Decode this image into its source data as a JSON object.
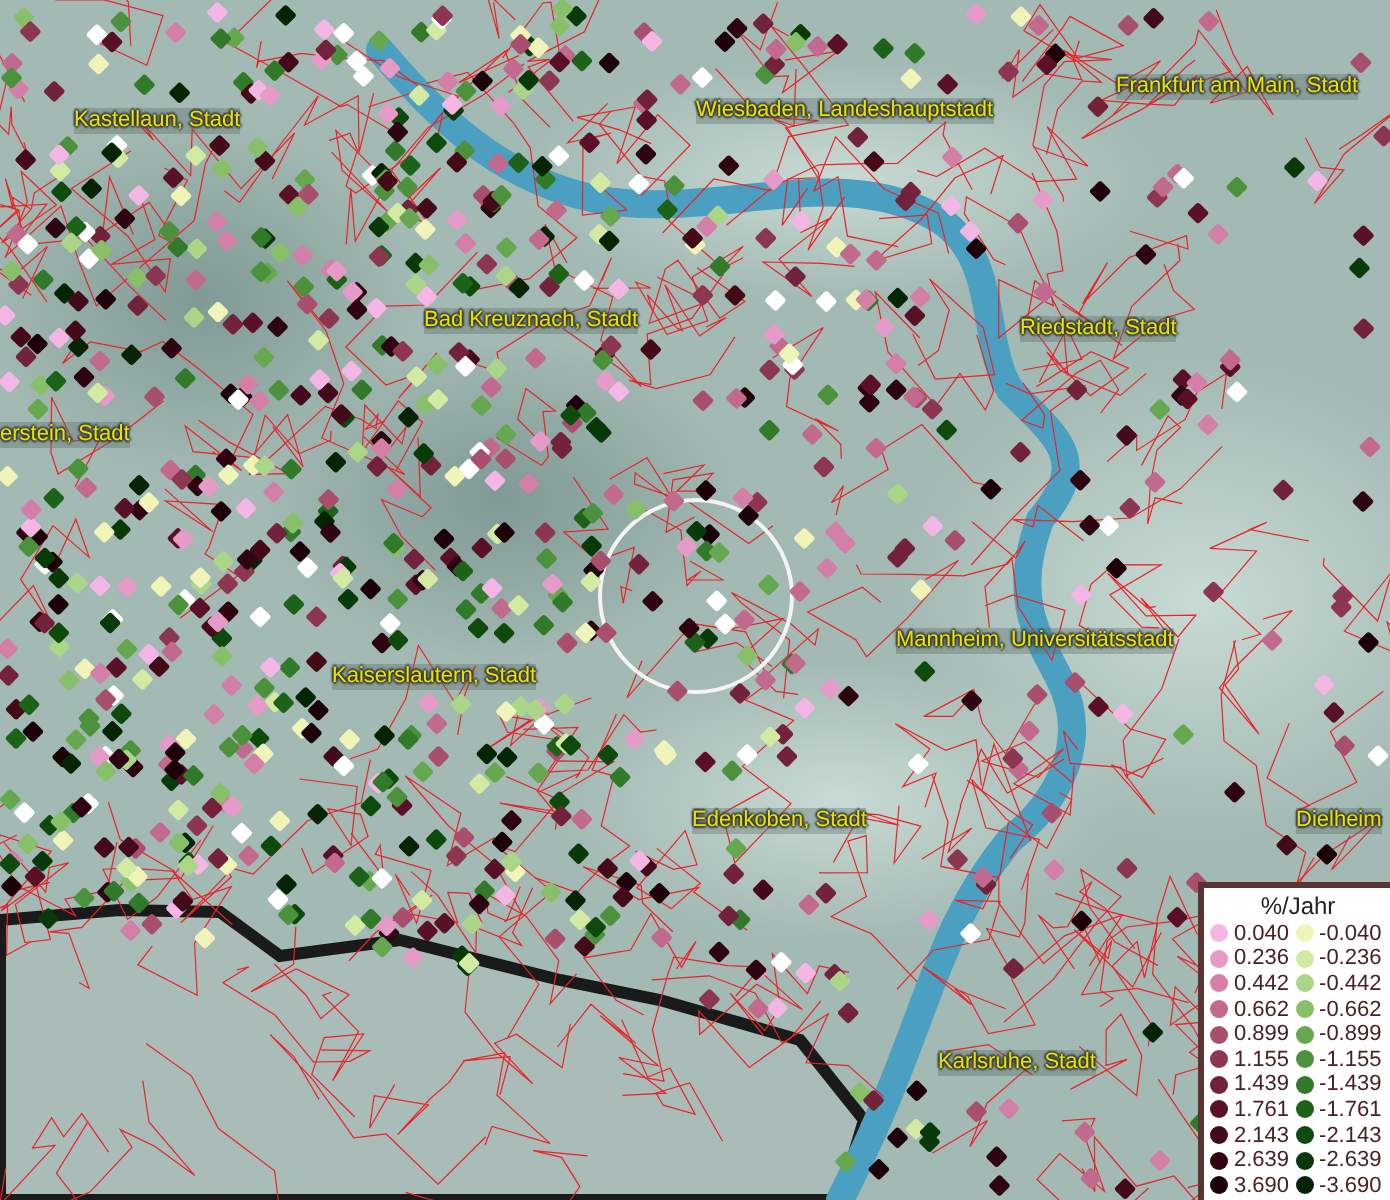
{
  "map": {
    "labels": [
      {
        "text": "Kastellaun, Stadt"
      },
      {
        "text": "Wiesbaden, Landeshauptstadt"
      },
      {
        "text": "Frankfurt am Main, Stadt"
      },
      {
        "text": "Bad Kreuznach, Stadt"
      },
      {
        "text": "Riedstadt, Stadt"
      },
      {
        "text": "erstein, Stadt"
      },
      {
        "text": "Mannheim, Universitätsstadt"
      },
      {
        "text": "Kaiserslautern, Stadt"
      },
      {
        "text": "Edenkoben, Stadt"
      },
      {
        "text": "Dielheim"
      },
      {
        "text": "Karlsruhe, Stadt"
      }
    ]
  },
  "legend": {
    "title": "%/Jahr",
    "positive": [
      {
        "value": "0.040",
        "color": "#f4b6e4"
      },
      {
        "value": "0.236",
        "color": "#e69ac8"
      },
      {
        "value": "0.442",
        "color": "#d47fa8"
      },
      {
        "value": "0.662",
        "color": "#c26a8e"
      },
      {
        "value": "0.899",
        "color": "#a84f6e"
      },
      {
        "value": "1.155",
        "color": "#8c3652"
      },
      {
        "value": "1.439",
        "color": "#72223a"
      },
      {
        "value": "1.761",
        "color": "#5a1026"
      },
      {
        "value": "2.143",
        "color": "#440a1a"
      },
      {
        "value": "2.639",
        "color": "#2e0410"
      },
      {
        "value": "3.690",
        "color": "#1c0208"
      }
    ],
    "negative": [
      {
        "value": "-0.040",
        "color": "#f0f4b8"
      },
      {
        "value": "-0.236",
        "color": "#d2eaa2"
      },
      {
        "value": "-0.442",
        "color": "#abd687"
      },
      {
        "value": "-0.662",
        "color": "#88c06a"
      },
      {
        "value": "-0.899",
        "color": "#66a850"
      },
      {
        "value": "-1.155",
        "color": "#4c923c"
      },
      {
        "value": "-1.439",
        "color": "#307a2a"
      },
      {
        "value": "-1.761",
        "color": "#1c6218"
      },
      {
        "value": "-2.143",
        "color": "#0e4a0c"
      },
      {
        "value": "-2.639",
        "color": "#073a08"
      },
      {
        "value": "-3.690",
        "color": "#042404"
      }
    ]
  }
}
